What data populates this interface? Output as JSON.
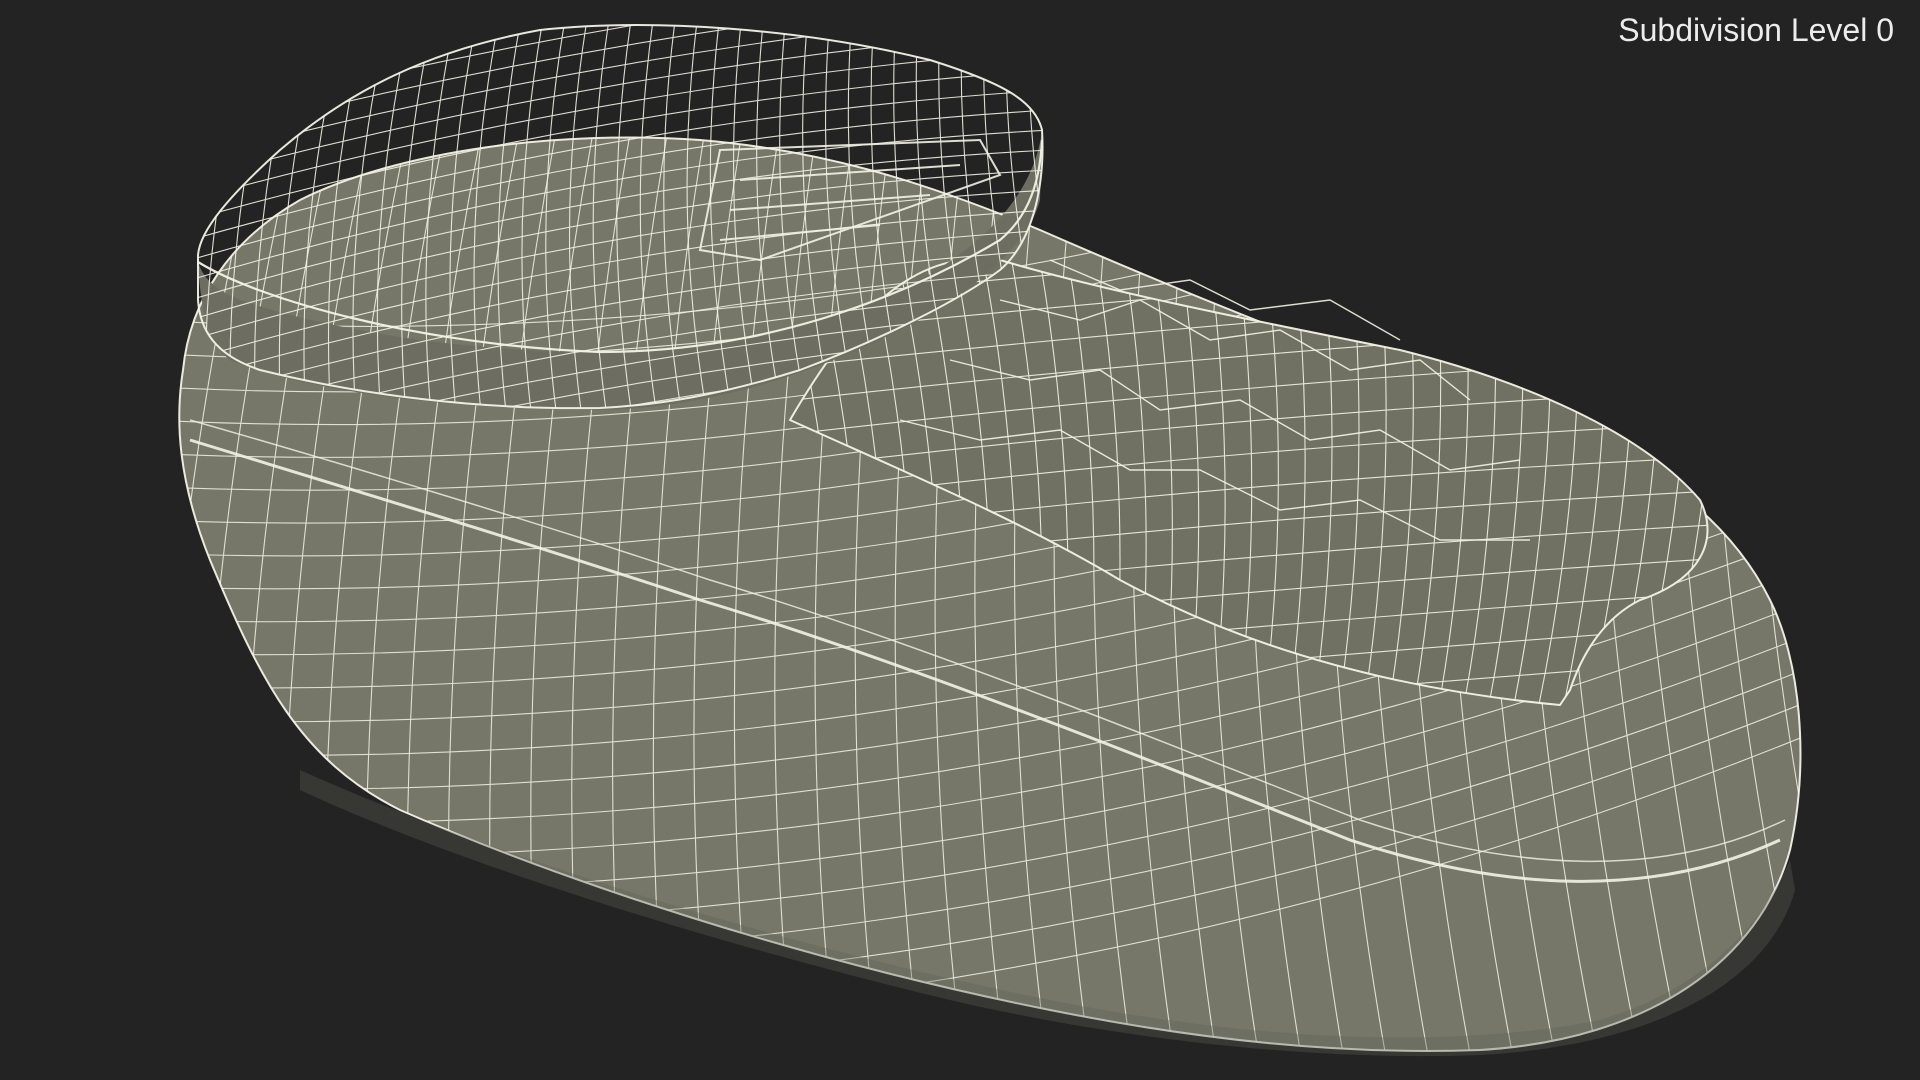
{
  "viewport": {
    "overlay_label": "Subdivision Level 0",
    "background_color": "#232323",
    "mesh_fill_color": "#767769",
    "mesh_dark_color": "#5f6055",
    "wire_color": "#f2f2e6"
  },
  "model": {
    "display_mode": "wireframe-on-shaded",
    "subject": "rounded pod-shaped object with raised top pad and front slot"
  }
}
